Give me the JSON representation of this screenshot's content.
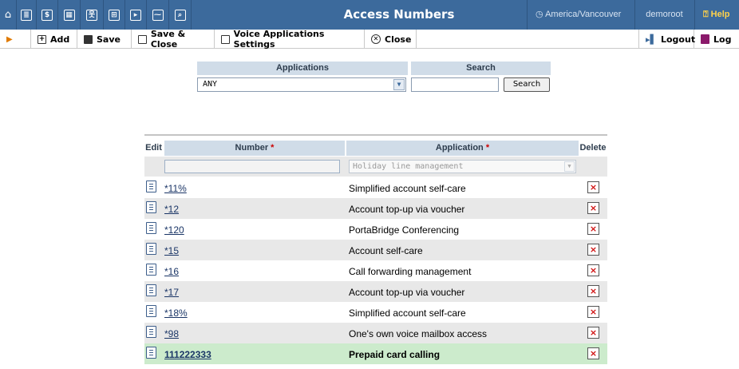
{
  "topbar": {
    "icons": [
      "home-icon",
      "list-icon",
      "dollar-icon",
      "grid-icon",
      "person-icon",
      "tree-icon",
      "flow-icon",
      "chart-icon",
      "search-icon"
    ],
    "icon_glyphs": [
      "⌂",
      "≣",
      "$",
      "▦",
      "웃",
      "⊞",
      "▸",
      "⁓",
      "⌕"
    ],
    "title": "Access Numbers",
    "timezone": "America/Vancouver",
    "timezone_icon": "clock-icon",
    "user": "demoroot",
    "help": "Help",
    "help_icon": "help-icon"
  },
  "toolbar": {
    "add": "Add",
    "save": "Save",
    "save_close": "Save & Close",
    "voice_settings": "Voice Applications Settings",
    "close": "Close",
    "logout": "Logout",
    "log": "Log"
  },
  "filter": {
    "applications_header": "Applications",
    "search_header": "Search",
    "applications_value": "ANY",
    "search_value": "",
    "search_button": "Search"
  },
  "table": {
    "headers": {
      "edit": "Edit",
      "number": "Number",
      "application": "Application",
      "delete": "Delete"
    },
    "required_mark": "*",
    "new_row": {
      "number": "",
      "application": "Holiday line management"
    },
    "rows": [
      {
        "number": "*11%",
        "application": "Simplified account self-care"
      },
      {
        "number": "*12",
        "application": "Account top-up via voucher"
      },
      {
        "number": "*120",
        "application": "PortaBridge Conferencing"
      },
      {
        "number": "*15",
        "application": "Account self-care"
      },
      {
        "number": "*16",
        "application": "Call forwarding management"
      },
      {
        "number": "*17",
        "application": "Account top-up via voucher"
      },
      {
        "number": "*18%",
        "application": "Simplified account self-care"
      },
      {
        "number": "*98",
        "application": "One's own voice mailbox access"
      },
      {
        "number": "111222333",
        "application": "Prepaid card calling"
      }
    ],
    "highlighted_row": 8
  },
  "colors": {
    "topbar": "#3c6a9c",
    "header_bg": "#d0dce8",
    "highlight_row": "#ccebcc",
    "delete_x": "#d01010"
  }
}
